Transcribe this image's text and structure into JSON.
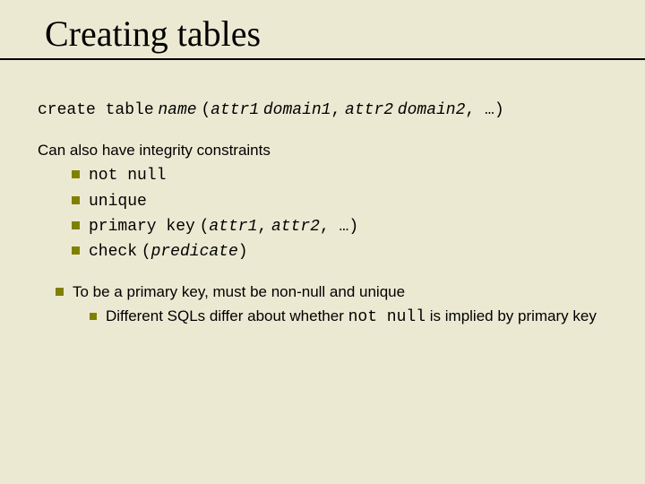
{
  "title": "Creating tables",
  "syntax": {
    "part1": "create table",
    "name": "name",
    "open": "(",
    "attr1": "attr1",
    "domain1": "domain1",
    "comma": ",",
    "attr2": "attr2",
    "domain2": "domain2",
    "tail": ", …)"
  },
  "constraints": {
    "intro": "Can also have integrity constraints",
    "items": [
      "not null",
      "unique"
    ],
    "pk": {
      "kw": "primary key",
      "open": "(",
      "a1": "attr1",
      "c": ",",
      "a2": "attr2",
      "tail": ", …)"
    },
    "check": {
      "kw": "check",
      "open": "(",
      "pred": "predicate",
      "close": ")"
    }
  },
  "note": {
    "main": "To be a primary key, must be non-null and unique",
    "sub_pre": "Different SQLs differ about whether",
    "sub_code": "not null",
    "sub_post": "is implied by primary key"
  }
}
